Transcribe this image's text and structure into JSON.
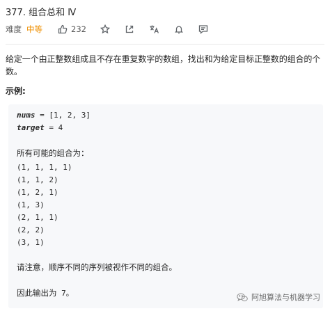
{
  "problem": {
    "title": "377. 组合总和 Ⅳ",
    "difficulty_label": "难度",
    "difficulty_value": "中等",
    "likes": "232"
  },
  "icons": [
    "thumb-up-icon",
    "star-icon",
    "share-icon",
    "translate-icon",
    "bell-icon",
    "comment-icon"
  ],
  "colors": {
    "difficulty_medium": "#ef8f00",
    "code_background": "#f7f8fa"
  },
  "description": "给定一个由正整数组成且不存在重复数字的数组，找出和为给定目标正整数的组合的个数。",
  "example_title": "示例:",
  "code_block": {
    "nums_var": "nums",
    "nums_rest": " = [1, 2, 3]",
    "target_var": "target",
    "target_rest": " = 4",
    "combos_heading": "所有可能的组合为：",
    "combos": [
      "(1, 1, 1, 1)",
      "(1, 1, 2)",
      "(1, 2, 1)",
      "(1, 3)",
      "(2, 1, 1)",
      "(2, 2)",
      "(3, 1)"
    ],
    "note": "请注意，顺序不同的序列被视作不同的组合。",
    "answer_text": "因此输出为",
    "answer_value": " 7。"
  },
  "watermark": "阿旭算法与机器学习"
}
